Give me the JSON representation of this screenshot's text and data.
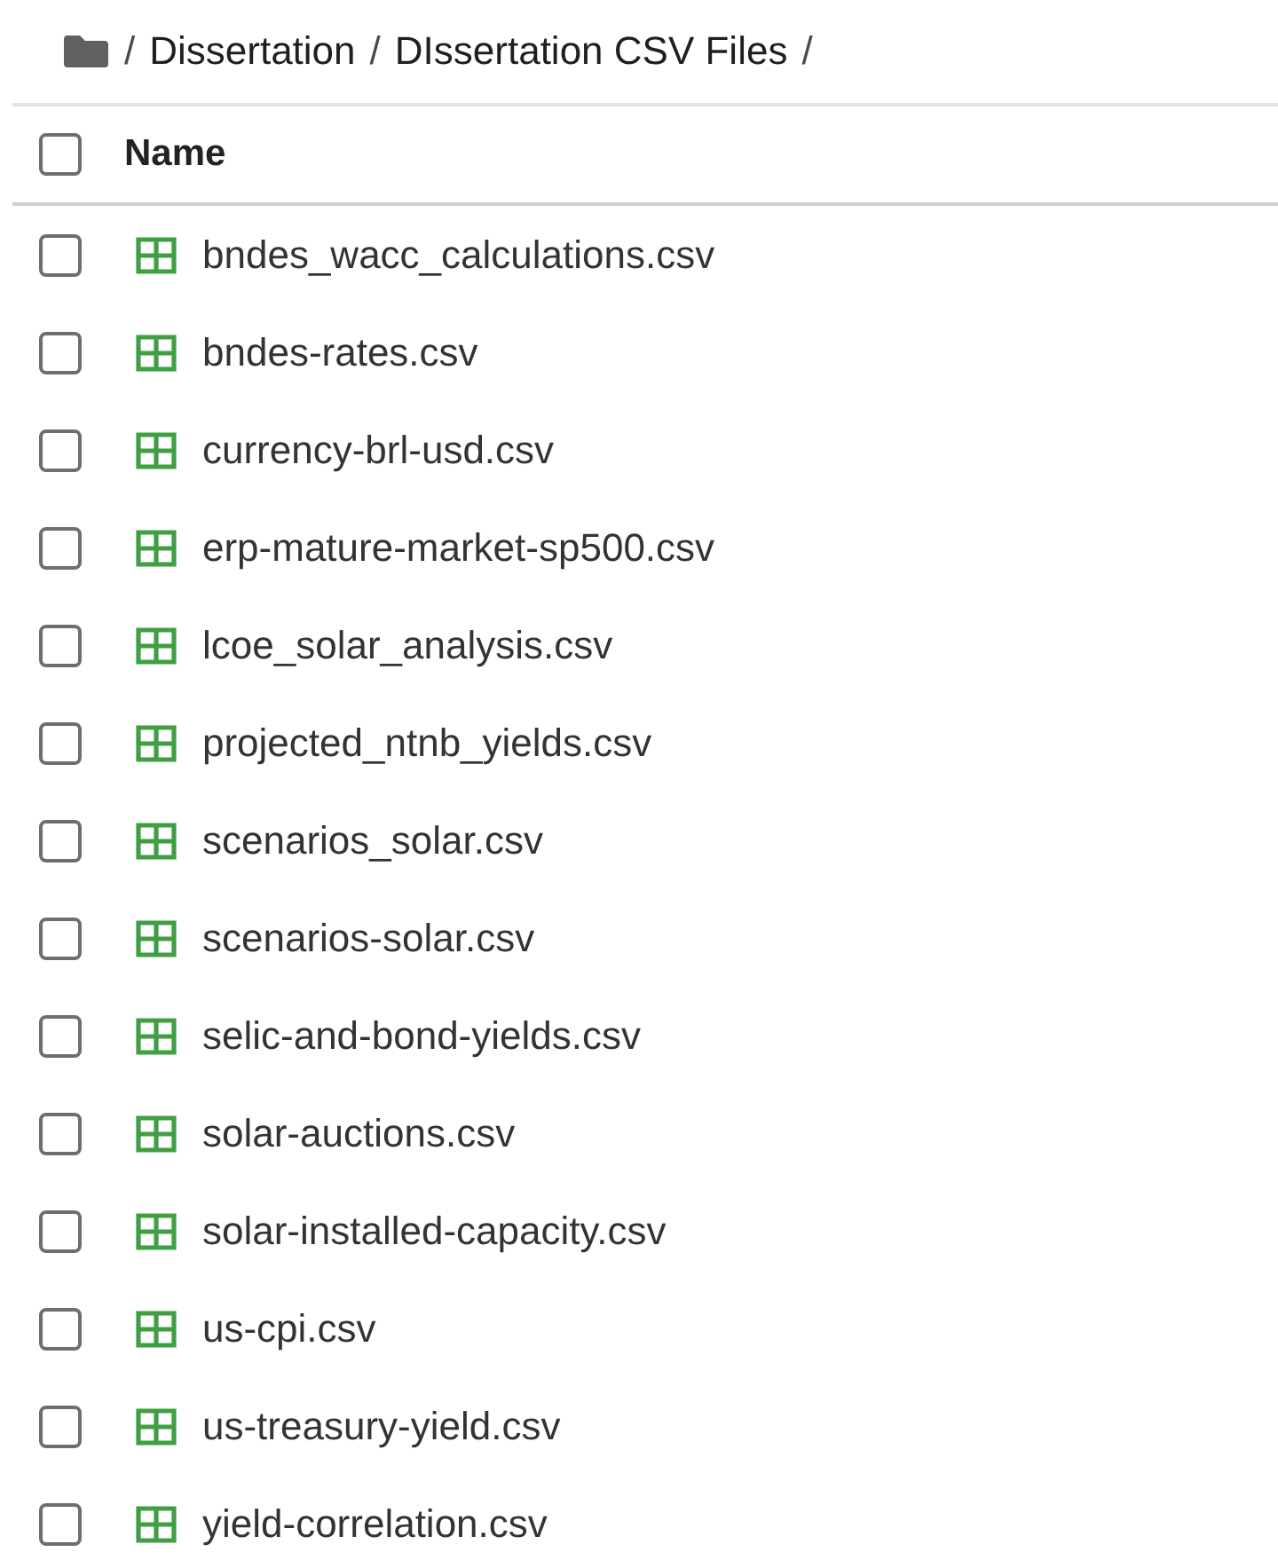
{
  "breadcrumb": [
    {
      "kind": "separator",
      "text": "/"
    },
    {
      "kind": "crumb",
      "text": "Dissertation"
    },
    {
      "kind": "separator",
      "text": "/"
    },
    {
      "kind": "crumb",
      "text": "DIssertation CSV Files"
    },
    {
      "kind": "separator",
      "text": "/"
    }
  ],
  "header": {
    "label": "Name",
    "checked": false
  },
  "files": [
    {
      "name": "bndes_wacc_calculations.csv",
      "checked": false
    },
    {
      "name": "bndes-rates.csv",
      "checked": false
    },
    {
      "name": "currency-brl-usd.csv",
      "checked": false
    },
    {
      "name": "erp-mature-market-sp500.csv",
      "checked": false
    },
    {
      "name": "lcoe_solar_analysis.csv",
      "checked": false
    },
    {
      "name": "projected_ntnb_yields.csv",
      "checked": false
    },
    {
      "name": "scenarios_solar.csv",
      "checked": false
    },
    {
      "name": "scenarios-solar.csv",
      "checked": false
    },
    {
      "name": "selic-and-bond-yields.csv",
      "checked": false
    },
    {
      "name": "solar-auctions.csv",
      "checked": false
    },
    {
      "name": "solar-installed-capacity.csv",
      "checked": false
    },
    {
      "name": "us-cpi.csv",
      "checked": false
    },
    {
      "name": "us-treasury-yield.csv",
      "checked": false
    },
    {
      "name": "yield-correlation.csv",
      "checked": false
    }
  ]
}
